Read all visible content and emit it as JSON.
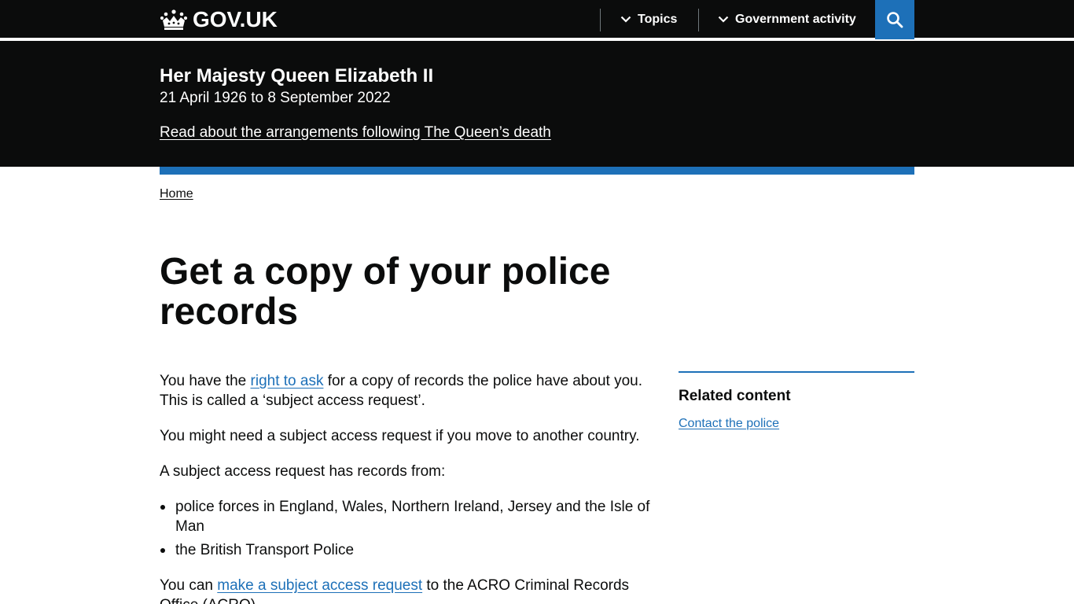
{
  "header": {
    "logo_text": "GOV.UK",
    "nav": [
      {
        "label": "Topics"
      },
      {
        "label": "Government activity"
      }
    ],
    "search_label": "Search"
  },
  "banner": {
    "title": "Her Majesty Queen Elizabeth II",
    "dates": "21 April 1926 to 8 September 2022",
    "link": "Read about the arrangements following The Queen’s death"
  },
  "breadcrumb": {
    "home": "Home"
  },
  "page_title": "Get a copy of your police records",
  "content": {
    "p1_before": "You have the ",
    "p1_link": "right to ask",
    "p1_after": " for a copy of records the police have about you. This is called a ‘subject access request’.",
    "p2": "You might need a subject access request if you move to another country.",
    "p3": "A subject access request has records from:",
    "list": [
      "police forces in England, Wales, Northern Ireland, Jersey and the Isle of Man",
      "the British Transport Police"
    ],
    "p4_before": "You can ",
    "p4_link": "make a subject access request",
    "p4_after": " to the ACRO Criminal Records Office (ACRO)."
  },
  "related": {
    "heading": "Related content",
    "links": [
      "Contact the police"
    ]
  },
  "colors": {
    "header_bg": "#0b0c0c",
    "link_blue": "#1d70b8",
    "text": "#0b0c0c"
  }
}
